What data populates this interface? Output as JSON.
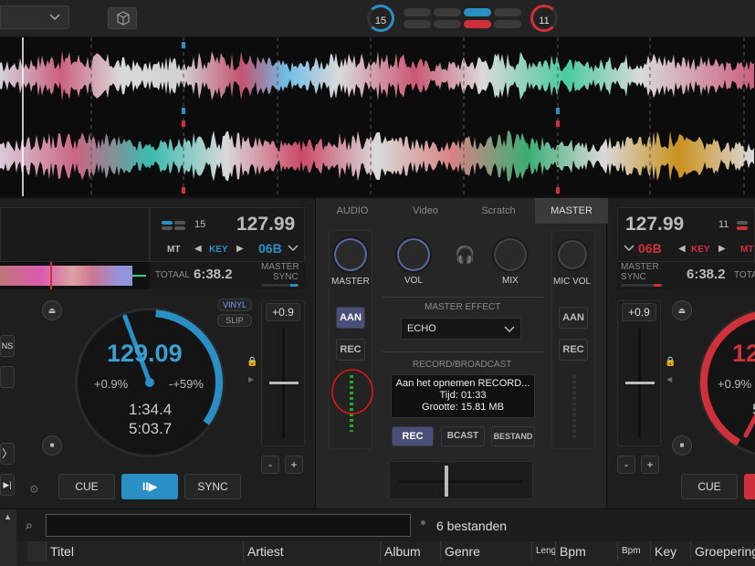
{
  "topbar": {
    "counter_left": "15",
    "counter_right": "11",
    "colors": {
      "blue": "#2a8fc4",
      "red": "#d0303a",
      "pill_off": "#3a3a3a"
    }
  },
  "left_deck": {
    "beat_counter": "15",
    "bpm": "127.99",
    "mode": "MT",
    "key_label": "KEY",
    "key_value": "06B",
    "total_label": "TOTAAL",
    "total_time": "6:38.2",
    "master_label": "MASTER",
    "sync_label": "SYNC",
    "vinyl_label": "VINYL",
    "slip_label": "SLIP",
    "jog_bpm": "129.09",
    "pitch_left": "+0.9%",
    "pitch_right": "-+59%",
    "elapsed": "1:34.4",
    "remaining": "5:03.7",
    "pitch_value": "+0.9",
    "minus": "-",
    "plus": "+",
    "cue_label": "CUE",
    "play_label": "II▶",
    "sync_button": "SYNC",
    "edge_label": "NS"
  },
  "mixer": {
    "tabs": [
      "AUDIO",
      "Video",
      "Scratch",
      "MASTER"
    ],
    "active_tab": "MASTER",
    "master_knob_label": "MASTER",
    "vol_label": "VOL",
    "mix_label": "MIX",
    "mic_vol_label": "MIC VOL",
    "aan_label": "AAN",
    "rec_label": "REC",
    "master_effect_label": "MASTER EFFECT",
    "effect_value": "ECHO",
    "record_broadcast_label": "RECORD/BROADCAST",
    "record_status_line1": "Aan het opnemen RECORD...",
    "record_status_line2": "Tijd: 01:33",
    "record_status_line3": "Grootte: 15.81 MB",
    "rec_button": "REC",
    "bcast_button": "BCAST",
    "bestand_button": "BESTAND",
    "mic_aan": "AAN",
    "mic_rec": "REC"
  },
  "right_deck": {
    "bpm": "127.99",
    "beat_counter": "11",
    "key_value": "06B",
    "key_label": "KEY",
    "mode": "MT",
    "master_label": "MASTER",
    "sync_label": "SYNC",
    "total_time": "6:38.2",
    "total_label": "TOTA",
    "pitch_value": "+0.9",
    "minus": "-",
    "plus": "+",
    "jog_bpm": "12",
    "pitch_left": "+0.9%",
    "elapsed_partial": "5",
    "cue_label": "CUE"
  },
  "browser": {
    "search_placeholder": "",
    "file_count": "6 bestanden",
    "columns": [
      "Titel",
      "Artiest",
      "Album",
      "Genre",
      "Leng",
      "Bpm",
      "Bpm ve",
      "Key",
      "Groepering"
    ]
  }
}
